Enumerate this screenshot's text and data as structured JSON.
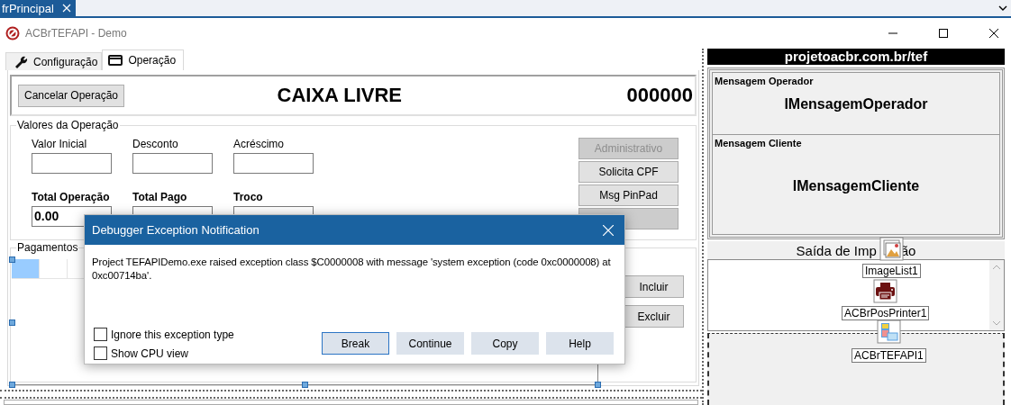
{
  "ide_tabs": [
    {
      "label": "frPrincipal",
      "selected": true
    }
  ],
  "window": {
    "title": "ACBrTEFAPI - Demo"
  },
  "tabs": [
    {
      "label": "Configuração",
      "selected": false
    },
    {
      "label": "Operação",
      "selected": true
    }
  ],
  "status_panel": {
    "button": "Cancelar Operação",
    "status": "CAIXA LIVRE",
    "counter": "000000"
  },
  "valores": {
    "title": "Valores da Operação",
    "fields": [
      {
        "label": "Valor Inicial",
        "kind": "input"
      },
      {
        "label": "Desconto",
        "kind": "input"
      },
      {
        "label": "Acréscimo",
        "kind": "input"
      },
      {
        "label": "Total Operação",
        "kind": "total",
        "value": "0.00"
      },
      {
        "label": "Total Pago",
        "kind": "total"
      },
      {
        "label": "Troco",
        "kind": "total"
      }
    ],
    "buttons": [
      {
        "label": "Administrativo",
        "disabled": true
      },
      {
        "label": "Solicita CPF",
        "disabled": false
      },
      {
        "label": "Msg PinPad",
        "disabled": false
      },
      {
        "disabled": true
      }
    ]
  },
  "pagamentos": {
    "title": "Pagamentos",
    "cells": [
      {
        "selected": true
      },
      {
        "selected": false
      },
      {
        "selected": false
      }
    ],
    "buttons": [
      "Incluir",
      "Excluir"
    ]
  },
  "right_panel": {
    "link": "projetoacbr.com.br/tef",
    "sections": [
      {
        "caption": "Mensagem Operador",
        "message": "lMensagemOperador"
      },
      {
        "caption": "Mensagem Cliente",
        "message": "lMensagemCliente"
      }
    ],
    "output_title_parts": [
      "Saída de Imp",
      "ão"
    ]
  },
  "components": [
    {
      "name": "ImageList1",
      "kind": "imagelist"
    },
    {
      "name": "ACBrPosPrinter1",
      "kind": "printer"
    },
    {
      "name": "ACBrTEFAPI1",
      "kind": "tef"
    }
  ],
  "dialog": {
    "title": "Debugger Exception Notification",
    "message": "Project TEFAPIDemo.exe raised exception class $C0000008 with message 'system exception (code 0xc0000008) at 0xc00714ba'.",
    "options": [
      {
        "label": "Ignore this exception type",
        "checked": false
      },
      {
        "label": "Show CPU view",
        "checked": false
      }
    ],
    "buttons": [
      {
        "label": "Break",
        "focused": true
      },
      {
        "label": "Continue",
        "focused": false
      },
      {
        "label": "Copy",
        "focused": false
      },
      {
        "label": "Help",
        "focused": false
      }
    ]
  }
}
